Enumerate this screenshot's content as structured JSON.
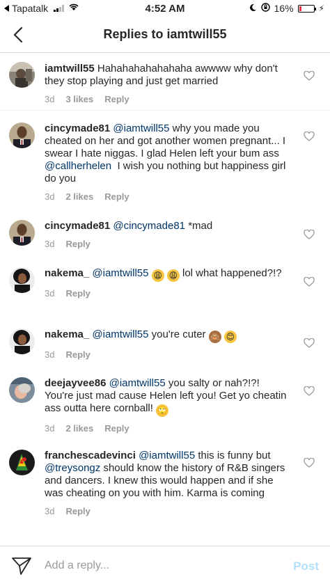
{
  "status_bar": {
    "carrier": "Tapatalk",
    "time": "4:52 AM",
    "battery": "16%",
    "battery_level": 0.16
  },
  "nav": {
    "title": "Replies to iamtwill55"
  },
  "comments": [
    {
      "user": "iamtwill55",
      "mention": "",
      "text": "Hahahahahahahaha awwww why don't they stop playing and just get married",
      "time": "3d",
      "likes": "3 likes",
      "reply": "Reply"
    },
    {
      "user": "cincymade81",
      "mention": "@iamtwill55",
      "text": "why you made you cheated on her and got another women pregnant... I swear I hate niggas. I glad Helen left your bum ass",
      "mention2": "@callherhelen",
      "text2": "I wish you nothing but happiness girl do you",
      "time": "3d",
      "likes": "2 likes",
      "reply": "Reply"
    },
    {
      "user": "cincymade81",
      "mention": "@cincymade81",
      "text": "*mad",
      "time": "3d",
      "likes": "",
      "reply": "Reply"
    },
    {
      "user": "nakema_",
      "mention": "@iamtwill55",
      "text_after_emoji": "lol what happened?!?",
      "time": "3d",
      "likes": "",
      "reply": "Reply"
    },
    {
      "user": "nakema_",
      "mention": "@iamtwill55",
      "text": "you're cuter",
      "time": "3d",
      "likes": "",
      "reply": "Reply"
    },
    {
      "user": "deejayvee86",
      "mention": "@iamtwill55",
      "text": "you salty or nah?!?! You're just mad cause Helen left you! Get yo cheatin ass outta here cornball!",
      "time": "3d",
      "likes": "2 likes",
      "reply": "Reply"
    },
    {
      "user": "franchescadevinci",
      "mention": "@iamtwill55",
      "text": "this is funny but",
      "mention2": "@treysongz",
      "text2": "should know the history of R&B singers and dancers. I knew this would happen and if she was cheating on you with him. Karma is coming",
      "time": "3d",
      "likes": "",
      "reply": "Reply"
    }
  ],
  "reply_bar": {
    "placeholder": "Add a reply...",
    "post_label": "Post"
  },
  "colors": {
    "mention": "#003569",
    "post_disabled": "#b2dffc",
    "meta": "#999999"
  }
}
